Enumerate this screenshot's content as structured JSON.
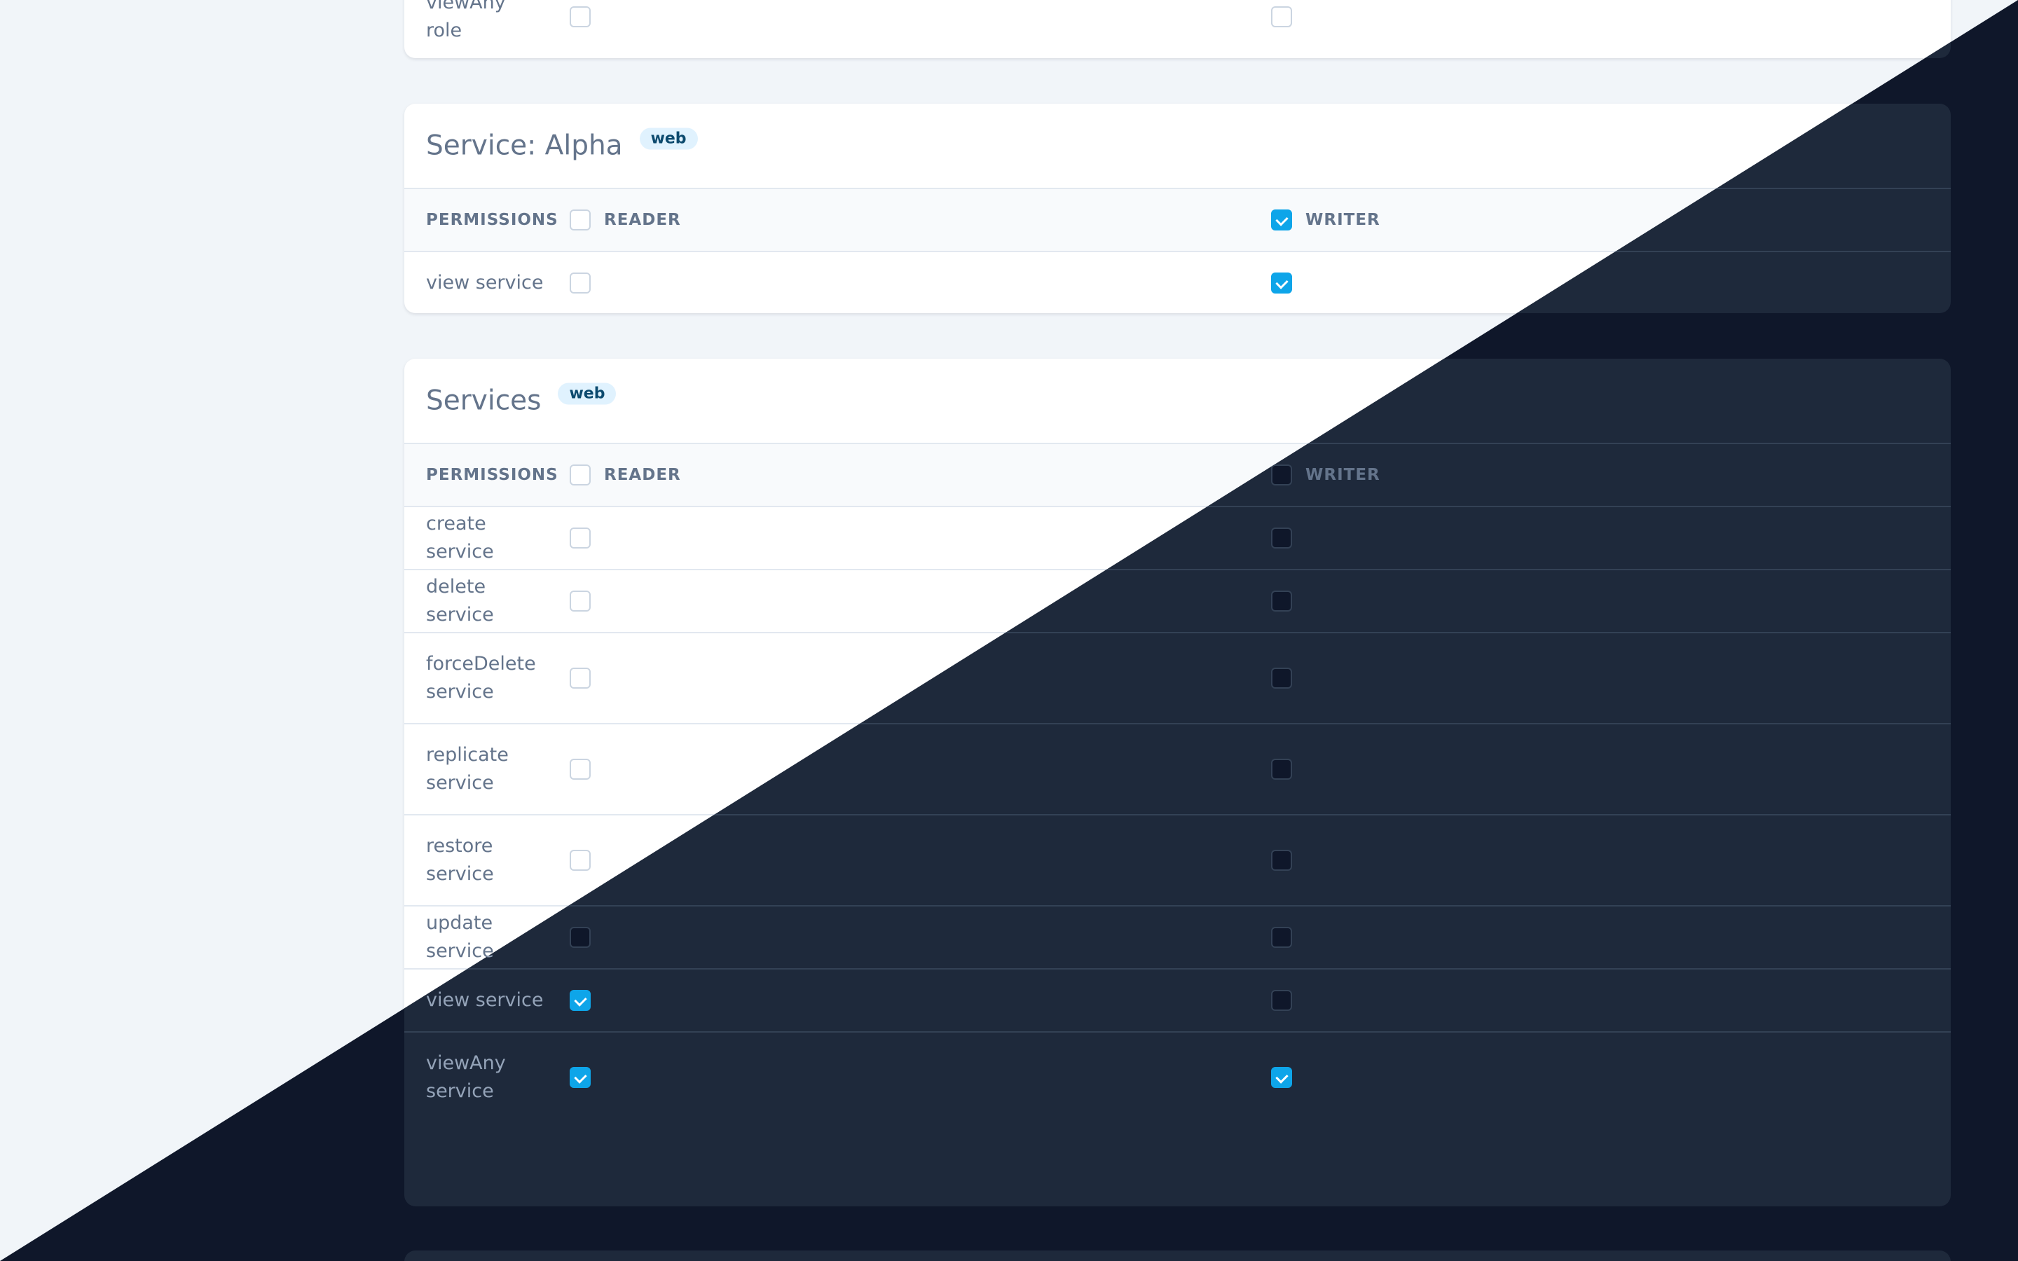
{
  "role_card": {
    "last_row": {
      "label": "viewAny role",
      "reader_checked": false,
      "writer_checked": false
    }
  },
  "alpha": {
    "title": "Service: Alpha",
    "badge": "web",
    "header": {
      "permissions": "PERMISSIONS",
      "reader": "READER",
      "writer": "WRITER",
      "reader_checked": false,
      "writer_checked": true
    },
    "rows": [
      {
        "label": "view service",
        "reader_checked": false,
        "writer_checked": true
      }
    ]
  },
  "services": {
    "title": "Services",
    "badge": "web",
    "header": {
      "permissions": "PERMISSIONS",
      "reader": "READER",
      "writer": "WRITER",
      "reader_checked": false,
      "writer_checked": false
    },
    "rows": [
      {
        "label": "create service",
        "reader_checked": false,
        "writer_checked": false
      },
      {
        "label": "delete service",
        "reader_checked": false,
        "writer_checked": false
      },
      {
        "label": "forceDelete service",
        "reader_checked": false,
        "writer_checked": false
      },
      {
        "label": "replicate service",
        "reader_checked": false,
        "writer_checked": false
      },
      {
        "label": "restore service",
        "reader_checked": false,
        "writer_checked": false
      },
      {
        "label": "update service",
        "reader_checked": false,
        "writer_checked": false
      },
      {
        "label": "view service",
        "reader_checked": true,
        "writer_checked": false
      },
      {
        "label": "viewAny service",
        "reader_checked": true,
        "writer_checked": true
      }
    ]
  },
  "colors": {
    "accent": "#0ea5e9",
    "light_background": "#f1f5f9",
    "dark_background": "#0f172a",
    "dark_card": "#1e293b"
  }
}
